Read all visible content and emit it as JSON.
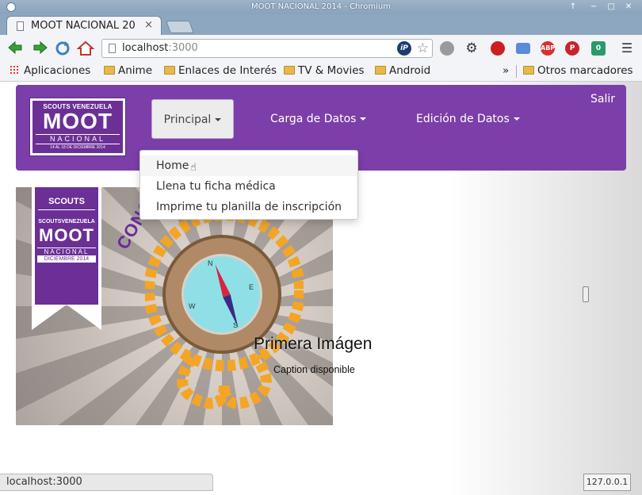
{
  "window": {
    "title": "MOOT NACIONAL 2014 - Chromium",
    "controls": [
      "↑",
      "−",
      "□",
      "✕"
    ]
  },
  "tabs": [
    {
      "title": "MOOT NACIONAL 20",
      "close": "×"
    }
  ],
  "toolbar": {
    "back_icon": "arrow-left",
    "forward_icon": "arrow-right",
    "reload_icon": "reload",
    "home_icon": "home",
    "url_host": "localhost",
    "url_port": ":3000",
    "ip_badge": "iP",
    "star": "☆",
    "extensions": [
      {
        "name": "globe-extension",
        "label": "",
        "color": "#8a8a8a"
      },
      {
        "name": "gear-extension",
        "label": "⚙",
        "color": "#444"
      },
      {
        "name": "record-extension",
        "label": "",
        "color": "#cc1f1f"
      },
      {
        "name": "keyboard-extension",
        "label": "",
        "color": "#5a8ad8"
      },
      {
        "name": "adblock-extension",
        "label": "ABP",
        "color": "#d83030"
      },
      {
        "name": "pinterest-extension",
        "label": "P",
        "color": "#c8232c"
      },
      {
        "name": "counter-extension",
        "label": "0",
        "color": "#2a9a6a"
      }
    ],
    "menu_icon": "☰"
  },
  "bookmarks": {
    "apps": "Aplicaciones",
    "items": [
      "Anime",
      "Enlaces de Interés",
      "TV & Movies",
      "Android"
    ],
    "overflow": "»",
    "others": "Otros marcadores"
  },
  "navbar": {
    "brand": {
      "top": "SCOUTS VENEZUELA",
      "main": "MOOT",
      "sub": "NACIONAL",
      "date": "14 AL 18 DE DICIEMBRE 2014"
    },
    "items": [
      {
        "label": "Principal",
        "active": true
      },
      {
        "label": "Carga de Datos",
        "active": false
      },
      {
        "label": "Edición de Datos",
        "active": false
      }
    ],
    "logout": "Salir",
    "accent": "#7c3ea8"
  },
  "dropdown": {
    "items": [
      "Home",
      "Llena tu ficha médica",
      "Imprime tu planilla de inscripción"
    ]
  },
  "carousel": {
    "banner": {
      "scouts": "SCOUTS",
      "sv": "SCOUTSVENEZUELA",
      "moot": "MOOT",
      "nacional": "NACIONAL",
      "date": "DICIEMBRE 2014"
    },
    "arc_text": "CONQUISTA",
    "compass_dirs": {
      "n": "N",
      "e": "E",
      "s": "S",
      "w": "W"
    },
    "caption_title": "Primera Imágen",
    "caption_text": "Caption disponible"
  },
  "statusbar": {
    "url": "localhost:3000",
    "ip": "127.0.0.1"
  }
}
